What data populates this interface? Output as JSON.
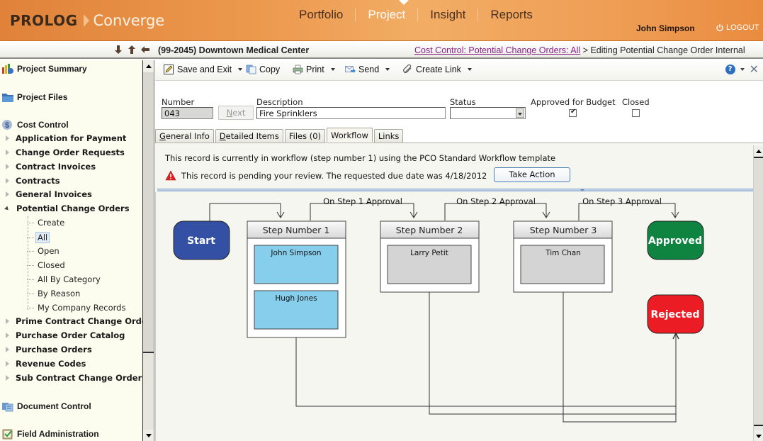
{
  "header": {
    "logo_primary": "PROLOG",
    "logo_secondary": "Converge",
    "nav": [
      {
        "label": "Portfolio",
        "active": false
      },
      {
        "label": "Project",
        "active": true
      },
      {
        "label": "Insight",
        "active": false
      },
      {
        "label": "Reports",
        "active": false
      }
    ],
    "user_name": "John Simpson",
    "logout_label": "LOGOUT"
  },
  "context": {
    "nav_icons": [
      "arrow-down-icon",
      "arrow-up-icon",
      "arrow-left-icon"
    ],
    "project_title": "(99-2045) Downtown Medical Center",
    "breadcrumb_link": "Cost Control: Potential Change Orders: All",
    "breadcrumb_separator": ">",
    "breadcrumb_current": "Editing Potential Change Order Internal"
  },
  "sidebar": {
    "sections": [
      {
        "label": "Project Summary",
        "icon": "chart-icon"
      },
      {
        "label": "Project Files",
        "icon": "folder-icon"
      },
      {
        "label": "Cost Control",
        "icon": "dollar-icon"
      },
      {
        "label": "Document Control",
        "icon": "documents-icon"
      },
      {
        "label": "Field Administration",
        "icon": "clipboard-icon"
      }
    ],
    "cost_items": [
      {
        "label": "Application for Payment",
        "expanded": false
      },
      {
        "label": "Change Order Requests",
        "expanded": false
      },
      {
        "label": "Contract Invoices",
        "expanded": false
      },
      {
        "label": "Contracts",
        "expanded": false
      },
      {
        "label": "General Invoices",
        "expanded": false
      },
      {
        "label": "Potential Change Orders",
        "expanded": true
      },
      {
        "label": "Prime Contract Change Orde",
        "expanded": false
      },
      {
        "label": "Purchase Order Catalog",
        "expanded": false
      },
      {
        "label": "Purchase Orders",
        "expanded": false
      },
      {
        "label": "Revenue Codes",
        "expanded": false
      },
      {
        "label": "Sub Contract Change Orders",
        "expanded": false
      }
    ],
    "pco_children": [
      {
        "label": "Create",
        "selected": false
      },
      {
        "label": "All",
        "selected": true
      },
      {
        "label": "Open",
        "selected": false
      },
      {
        "label": "Closed",
        "selected": false
      },
      {
        "label": "All By Category",
        "selected": false
      },
      {
        "label": "By Reason",
        "selected": false
      },
      {
        "label": "My Company Records",
        "selected": false
      }
    ]
  },
  "toolbar": {
    "save_exit": "Save and Exit",
    "copy": "Copy",
    "print": "Print",
    "send": "Send",
    "create_link": "Create Link",
    "help_glyph": "?",
    "close_glyph": "✕"
  },
  "form": {
    "number_label": "Number",
    "number_value": "043",
    "next_label": "Next",
    "description_label": "Description",
    "description_value": "Fire Sprinklers",
    "status_label": "Status",
    "status_value": "",
    "approved_label": "Approved for Budget",
    "approved_checked": true,
    "closed_label": "Closed",
    "closed_checked": false
  },
  "tabs": [
    {
      "label": "General Info",
      "accel": "G",
      "rest": "eneral Info",
      "active": false
    },
    {
      "label": "Detailed Items",
      "accel": "D",
      "rest": "etailed Items",
      "active": false
    },
    {
      "label": "Files (0)",
      "accel": "",
      "rest": "Files (0)",
      "active": false
    },
    {
      "label": "Workflow",
      "accel": "",
      "rest": "Workflow",
      "active": true
    },
    {
      "label": "Links",
      "accel": "",
      "rest": "Links",
      "active": false
    }
  ],
  "workflow": {
    "info_text": "This record is currently in workflow (step number 1) using the PCO Standard Workflow template",
    "warning_text": "This record is pending your review. The requested due date was 4/18/2012",
    "take_action_label": "Take Action",
    "colors": {
      "start": "#3450a4",
      "approved": "#0e8440",
      "rejected": "#ec1c24",
      "active_reviewer": "#87ceec",
      "pending_reviewer": "#d4d4d4"
    },
    "start_label": "Start",
    "approved_label": "Approved",
    "rejected_label": "Rejected",
    "transitions": [
      "On Step 1 Approval",
      "On Step 2 Approval",
      "On Step 3 Approval"
    ],
    "steps": [
      {
        "title": "Step Number 1",
        "active": true,
        "reviewers": [
          "John Simpson",
          "Hugh Jones"
        ]
      },
      {
        "title": "Step Number 2",
        "active": false,
        "reviewers": [
          "Larry Petit"
        ]
      },
      {
        "title": "Step Number 3",
        "active": false,
        "reviewers": [
          "Tim Chan"
        ]
      }
    ]
  }
}
